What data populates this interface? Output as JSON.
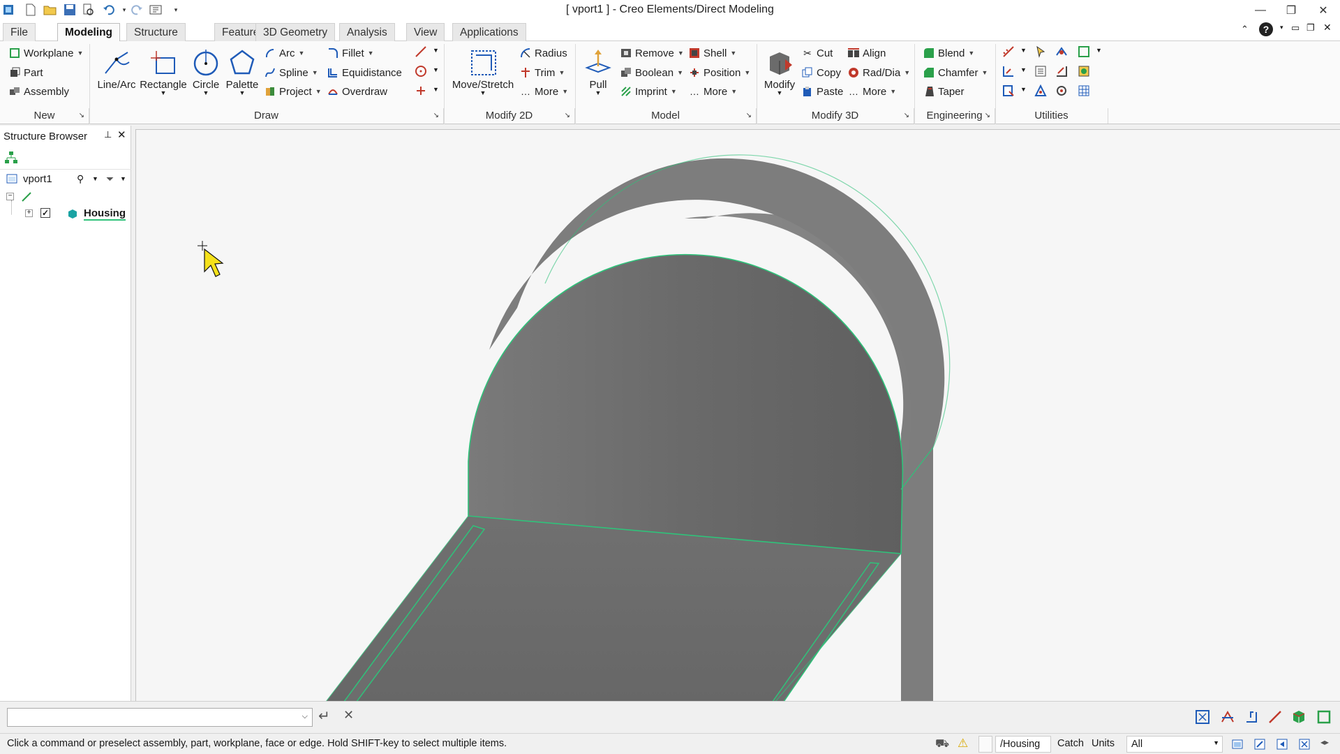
{
  "window": {
    "title": "[ vport1 ] - Creo Elements/Direct Modeling"
  },
  "tabs": [
    "File",
    "Modeling",
    "Structure",
    "Feature",
    "3D Geometry",
    "Analysis",
    "View",
    "Applications"
  ],
  "ribbon": {
    "new": {
      "label": "New",
      "workplane": "Workplane",
      "part": "Part",
      "assembly": "Assembly"
    },
    "draw": {
      "label": "Draw",
      "line_arc": "Line/Arc",
      "rectangle": "Rectangle",
      "circle": "Circle",
      "palette": "Palette",
      "arc": "Arc",
      "spline": "Spline",
      "project": "Project",
      "fillet": "Fillet",
      "equidistance": "Equidistance",
      "overdraw": "Overdraw"
    },
    "modify2d": {
      "label": "Modify 2D",
      "move_stretch": "Move/Stretch",
      "radius": "Radius",
      "trim": "Trim",
      "more": "More"
    },
    "model": {
      "label": "Model",
      "pull": "Pull",
      "remove": "Remove",
      "boolean": "Boolean",
      "imprint": "Imprint",
      "shell": "Shell",
      "position": "Position",
      "more": "More"
    },
    "modify3d": {
      "label": "Modify 3D",
      "modify": "Modify",
      "cut": "Cut",
      "copy": "Copy",
      "paste": "Paste",
      "align": "Align",
      "rad_dia": "Rad/Dia",
      "more": "More"
    },
    "engineering": {
      "label": "Engineering",
      "blend": "Blend",
      "chamfer": "Chamfer",
      "taper": "Taper"
    },
    "utilities": {
      "label": "Utilities"
    }
  },
  "browser": {
    "title": "Structure Browser",
    "viewport": "vport1",
    "tree_item": "Housing"
  },
  "cmdline": {
    "value": ""
  },
  "status": {
    "message": "Click a command or preselect assembly, part, workplane, face or edge. Hold SHIFT-key to select multiple items.",
    "current_part": "/Housing",
    "catch": "Catch",
    "units": "Units",
    "filter": "All"
  },
  "colors": {
    "model_face": "#6f6f6f",
    "edge_highlight": "#2fc27a",
    "accent_tab": "#1f6fd0"
  }
}
